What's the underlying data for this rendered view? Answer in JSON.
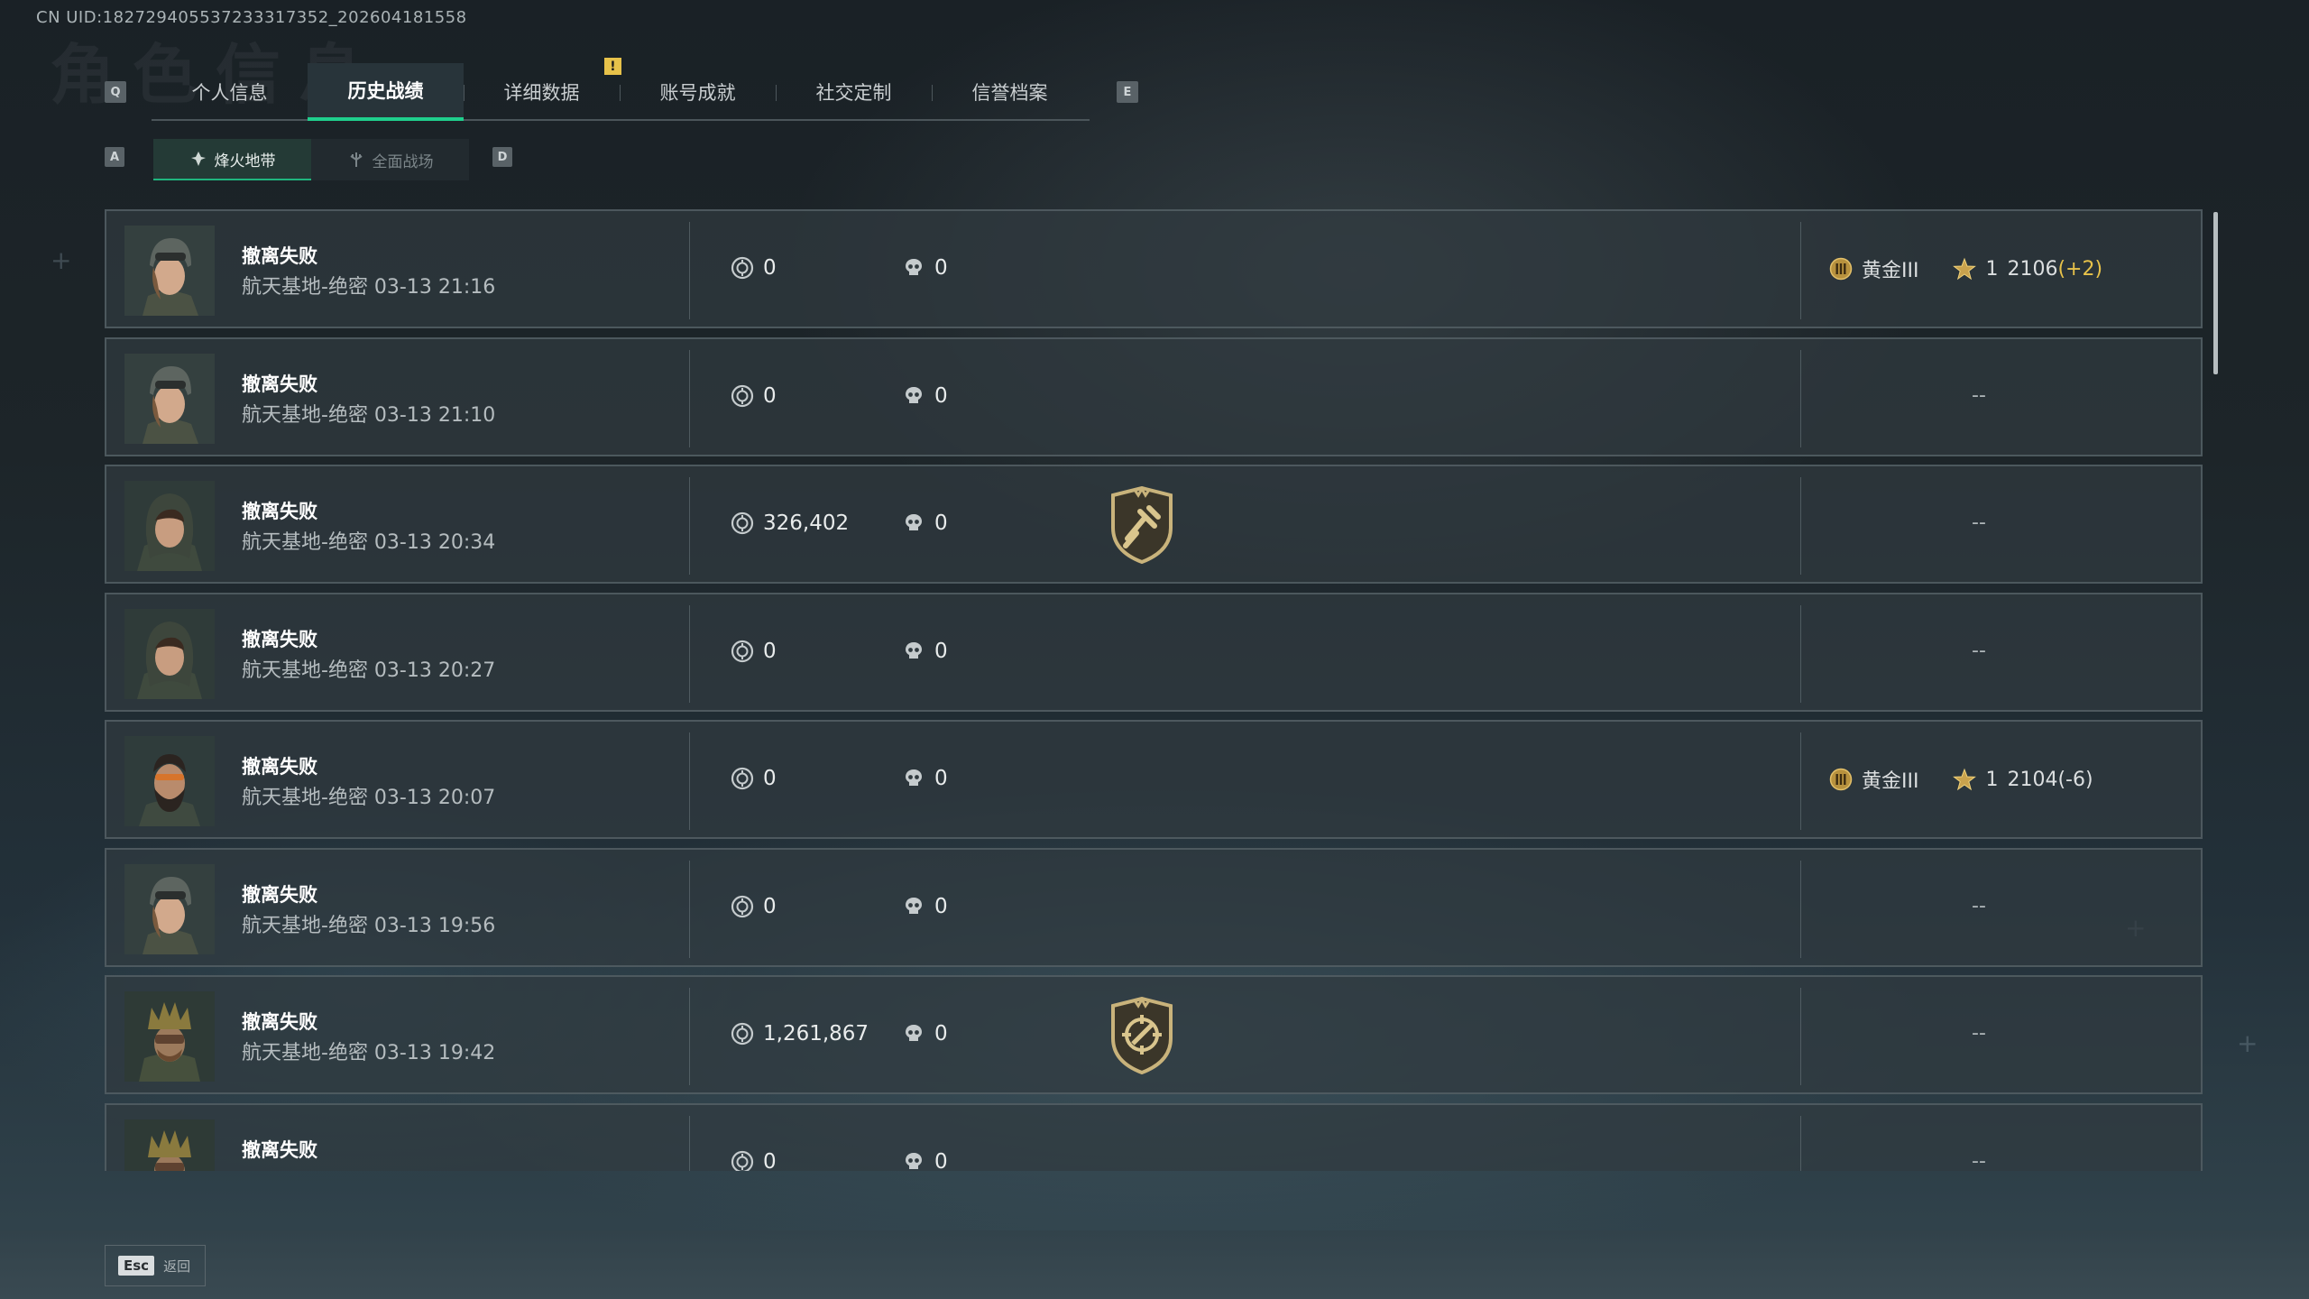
{
  "uid": "CN UID:182729405537233317352_202604181558",
  "page_bg_title": "角色信息",
  "keys": {
    "left_tab": "Q",
    "right_tab": "E",
    "left_sub": "A",
    "right_sub": "D"
  },
  "notification": "!",
  "tabs": [
    {
      "label": "个人信息"
    },
    {
      "label": "历史战绩"
    },
    {
      "label": "详细数据"
    },
    {
      "label": "账号成就"
    },
    {
      "label": "社交定制"
    },
    {
      "label": "信誉档案"
    }
  ],
  "subtabs": [
    {
      "label": "烽火地带",
      "icon": "fire-zone-icon"
    },
    {
      "label": "全面战场",
      "icon": "battlefield-icon"
    }
  ],
  "matches": [
    {
      "status": "撤离失败",
      "map": "航天基地-绝密",
      "time": "03-13 21:16",
      "money": "0",
      "kills": "0",
      "badge": "",
      "rank": {
        "tier": "黄金III",
        "stars": "1",
        "score": "2106",
        "delta": "(+2)"
      },
      "avatar": "female-soldier"
    },
    {
      "status": "撤离失败",
      "map": "航天基地-绝密",
      "time": "03-13 21:10",
      "money": "0",
      "kills": "0",
      "badge": "",
      "rank": null,
      "dash": "--",
      "avatar": "female-soldier"
    },
    {
      "status": "撤离失败",
      "map": "航天基地-绝密",
      "time": "03-13 20:34",
      "money": "326,402",
      "kills": "0",
      "badge": "hammer-badge-icon",
      "rank": null,
      "dash": "--",
      "avatar": "hooded-woman"
    },
    {
      "status": "撤离失败",
      "map": "航天基地-绝密",
      "time": "03-13 20:27",
      "money": "0",
      "kills": "0",
      "badge": "",
      "rank": null,
      "dash": "--",
      "avatar": "hooded-woman"
    },
    {
      "status": "撤离失败",
      "map": "航天基地-绝密",
      "time": "03-13 20:07",
      "money": "0",
      "kills": "0",
      "badge": "",
      "rank": {
        "tier": "黄金III",
        "stars": "1",
        "score": "2104",
        "delta": "(-6)"
      },
      "avatar": "bearded-man"
    },
    {
      "status": "撤离失败",
      "map": "航天基地-绝密",
      "time": "03-13 19:56",
      "money": "0",
      "kills": "0",
      "badge": "",
      "rank": null,
      "dash": "--",
      "avatar": "female-soldier"
    },
    {
      "status": "撤离失败",
      "map": "航天基地-绝密",
      "time": "03-13 19:42",
      "money": "1,261,867",
      "kills": "0",
      "badge": "crosshair-badge-icon",
      "rank": null,
      "dash": "--",
      "avatar": "crowned-soldier"
    },
    {
      "status": "撤离失败",
      "map": "",
      "time": "",
      "money": "0",
      "kills": "0",
      "badge": "",
      "rank": null,
      "dash": "--",
      "avatar": "crowned-soldier"
    }
  ],
  "footer": {
    "esc_key": "Esc",
    "back_label": "返回"
  },
  "colors": {
    "accent": "#1fcf8d",
    "gold": "#e7c24a",
    "row_bg": "#30393f"
  }
}
